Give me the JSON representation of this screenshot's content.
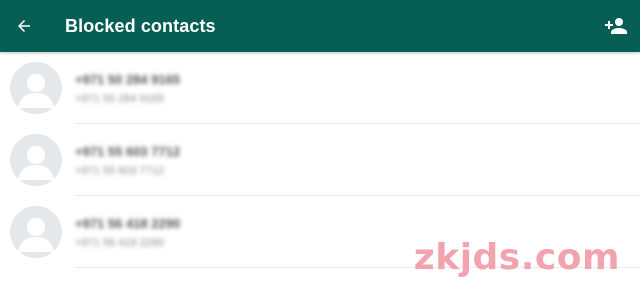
{
  "appbar": {
    "title": "Blocked contacts",
    "back_icon": "arrow-left-icon",
    "add_icon": "add-contact-icon",
    "color": "#075e54"
  },
  "contacts": [
    {
      "name": "+971 50 284 9165",
      "subtitle": "+971 50 284 9165"
    },
    {
      "name": "+971 55 603 7712",
      "subtitle": "+971 55 603 7712"
    },
    {
      "name": "+971 56 418 2290",
      "subtitle": "+971 56 418 2290"
    }
  ],
  "watermark": {
    "text": "zkjds.com"
  }
}
